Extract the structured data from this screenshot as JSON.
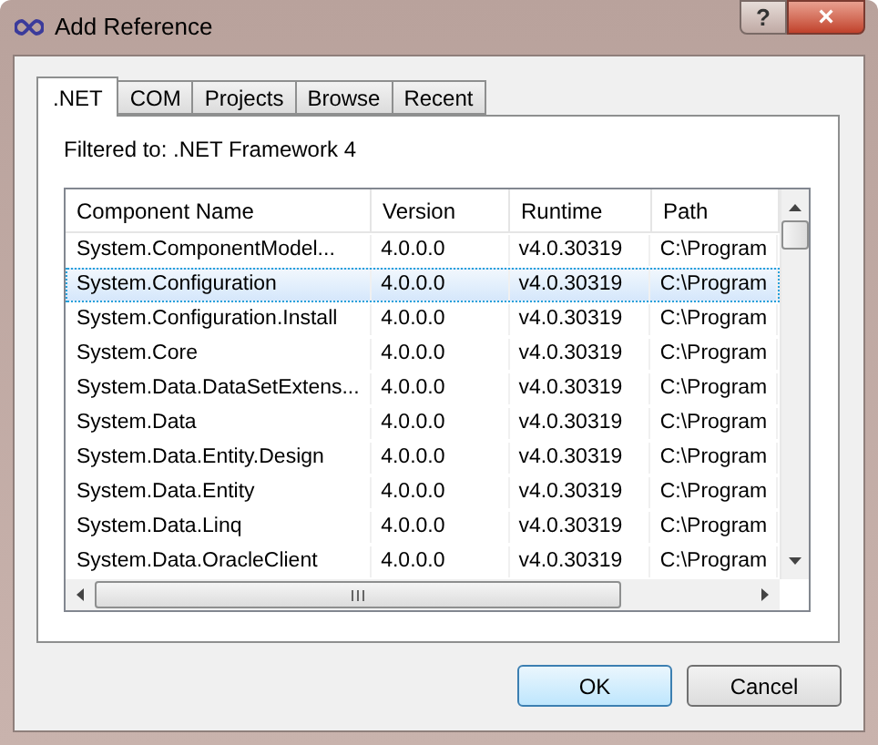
{
  "window": {
    "title": "Add Reference",
    "buttons": [
      "?",
      "×"
    ]
  },
  "tabs": [
    {
      "label": ".NET",
      "selected": true
    },
    {
      "label": "COM",
      "selected": false
    },
    {
      "label": "Projects",
      "selected": false
    },
    {
      "label": "Browse",
      "selected": false
    },
    {
      "label": "Recent",
      "selected": false
    }
  ],
  "filter_label": "Filtered to: .NET Framework 4",
  "table": {
    "columns": [
      "Component Name",
      "Version",
      "Runtime",
      "Path"
    ],
    "rows": [
      {
        "cells": [
          "System.ComponentModel...",
          "4.0.0.0",
          "v4.0.30319",
          "C:\\Program"
        ],
        "selected": false
      },
      {
        "cells": [
          "System.Configuration",
          "4.0.0.0",
          "v4.0.30319",
          "C:\\Program"
        ],
        "selected": true
      },
      {
        "cells": [
          "System.Configuration.Install",
          "4.0.0.0",
          "v4.0.30319",
          "C:\\Program"
        ],
        "selected": false
      },
      {
        "cells": [
          "System.Core",
          "4.0.0.0",
          "v4.0.30319",
          "C:\\Program"
        ],
        "selected": false
      },
      {
        "cells": [
          "System.Data.DataSetExtens...",
          "4.0.0.0",
          "v4.0.30319",
          "C:\\Program"
        ],
        "selected": false
      },
      {
        "cells": [
          "System.Data",
          "4.0.0.0",
          "v4.0.30319",
          "C:\\Program"
        ],
        "selected": false
      },
      {
        "cells": [
          "System.Data.Entity.Design",
          "4.0.0.0",
          "v4.0.30319",
          "C:\\Program"
        ],
        "selected": false
      },
      {
        "cells": [
          "System.Data.Entity",
          "4.0.0.0",
          "v4.0.30319",
          "C:\\Program"
        ],
        "selected": false
      },
      {
        "cells": [
          "System.Data.Linq",
          "4.0.0.0",
          "v4.0.30319",
          "C:\\Program"
        ],
        "selected": false
      },
      {
        "cells": [
          "System.Data.OracleClient",
          "4.0.0.0",
          "v4.0.30319",
          "C:\\Program"
        ],
        "selected": false
      }
    ]
  },
  "buttons": [
    {
      "label": "OK",
      "default": true
    },
    {
      "label": "Cancel",
      "default": false
    }
  ]
}
